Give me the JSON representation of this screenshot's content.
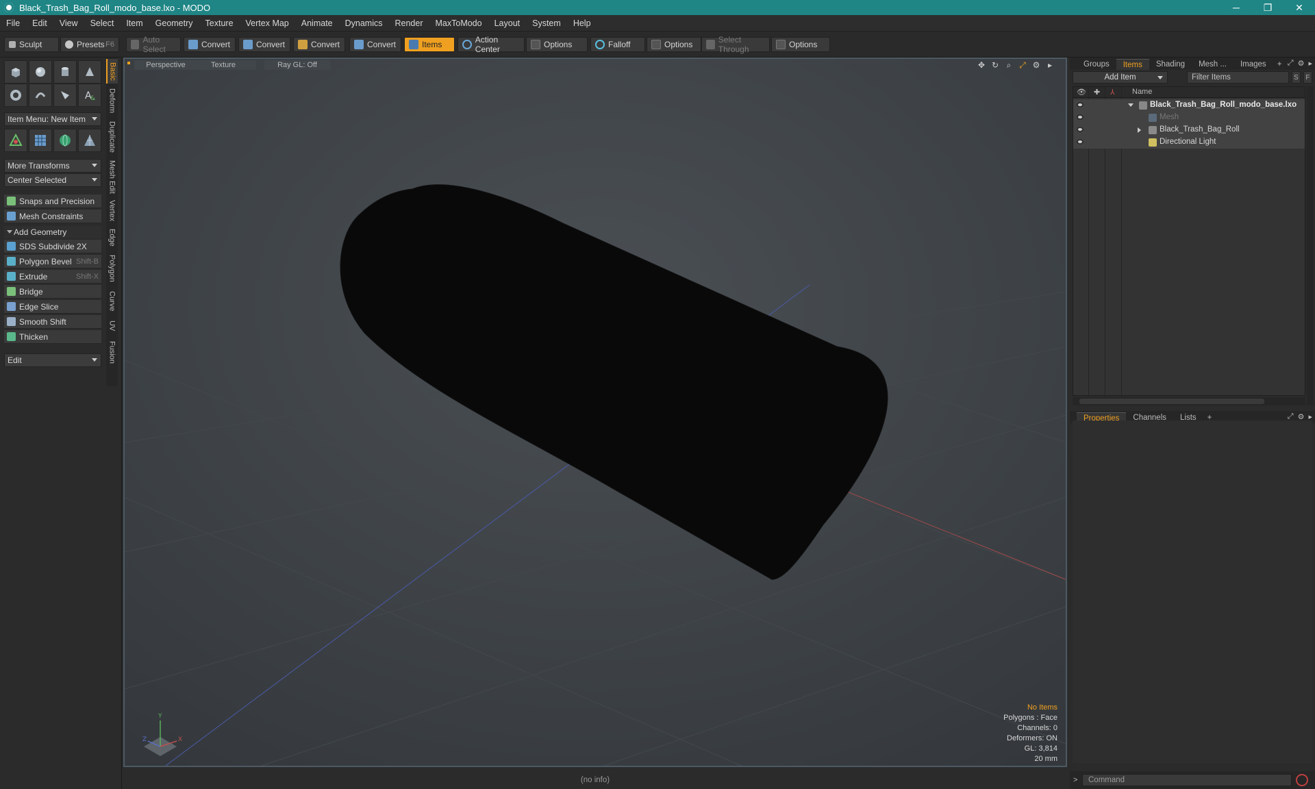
{
  "window": {
    "title": "Black_Trash_Bag_Roll_modo_base.lxo - MODO",
    "controls": [
      "─",
      "❐",
      "✕"
    ]
  },
  "menu": [
    "File",
    "Edit",
    "View",
    "Select",
    "Item",
    "Geometry",
    "Texture",
    "Vertex Map",
    "Animate",
    "Dynamics",
    "Render",
    "MaxToModo",
    "Layout",
    "System",
    "Help"
  ],
  "toolbar": {
    "sculpt": "Sculpt",
    "presets": "Presets",
    "presets_key": "F6",
    "auto_select": "Auto Select",
    "convert1": "Convert",
    "convert2": "Convert",
    "convert3": "Convert",
    "convert4": "Convert",
    "items": "Items",
    "action_center": "Action Center",
    "options1": "Options",
    "falloff": "Falloff",
    "options2": "Options",
    "select_through": "Select Through",
    "options3": "Options"
  },
  "left": {
    "item_menu": "Item Menu: New Item",
    "more_transforms": "More Transforms",
    "center_selected": "Center Selected",
    "snaps": "Snaps and Precision",
    "mesh_constraints": "Mesh Constraints",
    "add_geometry": "Add Geometry",
    "tools": [
      {
        "label": "SDS Subdivide 2X",
        "key": ""
      },
      {
        "label": "Polygon Bevel",
        "key": "Shift-B"
      },
      {
        "label": "Extrude",
        "key": "Shift-X"
      },
      {
        "label": "Bridge",
        "key": ""
      },
      {
        "label": "Edge Slice",
        "key": ""
      },
      {
        "label": "Smooth Shift",
        "key": ""
      },
      {
        "label": "Thicken",
        "key": ""
      }
    ],
    "edit_dropdown": "Edit",
    "vtabs": [
      "Basic",
      "Deform",
      "Duplicate",
      "Mesh Edit",
      "Vertex",
      "Edge",
      "Polygon",
      "Curve",
      "UV",
      "Fusion"
    ]
  },
  "viewport": {
    "view": "Perspective",
    "shading": "Texture",
    "raygl": "Ray GL: Off",
    "info": {
      "selection": "No Items",
      "polygons": "Polygons : Face",
      "channels": "Channels: 0",
      "deformers": "Deformers: ON",
      "gl": "GL: 3,814",
      "scale": "20 mm"
    },
    "axis_labels": {
      "y": "Y",
      "x": "X",
      "z": "Z"
    }
  },
  "status": "(no info)",
  "right": {
    "tabs": [
      "Groups",
      "Items",
      "Shading",
      "Mesh ...",
      "Images"
    ],
    "add_item": "Add Item",
    "filter_items": "Filter Items",
    "btn_s": "S",
    "btn_f": "F",
    "col_name": "Name",
    "items": [
      {
        "name": "Black_Trash_Bag_Roll_modo_base.lxo"
      },
      {
        "name": "Mesh"
      },
      {
        "name": "Black_Trash_Bag_Roll"
      },
      {
        "name": "Directional Light"
      }
    ],
    "bottom_tabs": [
      "Properties",
      "Channels",
      "Lists"
    ],
    "command_placeholder": "Command"
  },
  "colors": {
    "titlebar": "#1f8585",
    "accent": "#f0a020",
    "viewport_bg": "#383c40",
    "object": "#0a0a0a"
  }
}
